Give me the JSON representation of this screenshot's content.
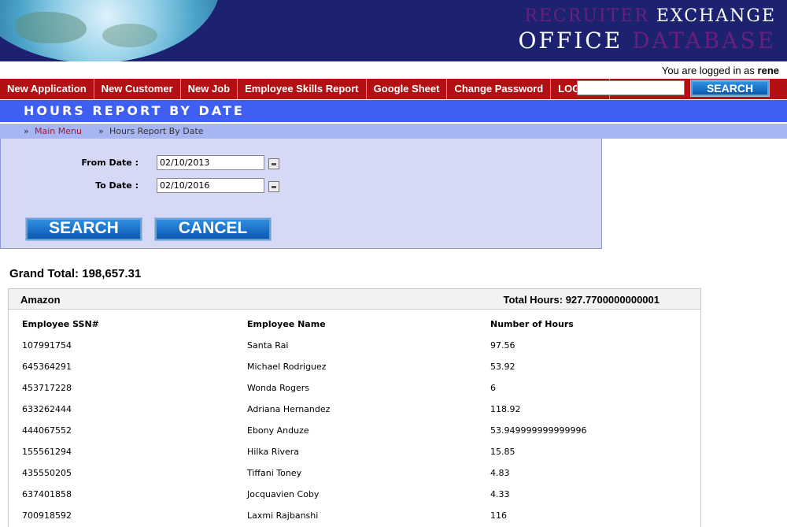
{
  "header": {
    "brand_line1_a": "RECRUITER",
    "brand_line1_b": "EXCHANGE",
    "brand_line2_a": "OFFICE",
    "brand_line2_b": "DATABASE",
    "logged_in_prefix": "You are logged in as",
    "username": "rene"
  },
  "nav": {
    "items": [
      "New Application",
      "New Customer",
      "New Job",
      "Employee Skills Report",
      "Google Sheet",
      "Change Password",
      "LOGOUT"
    ],
    "search_value": "",
    "search_button": "SEARCH"
  },
  "page": {
    "title": "HOURS REPORT BY DATE",
    "breadcrumb_marker": "»",
    "breadcrumb_main": "Main Menu",
    "breadcrumb_current": "Hours Report By Date"
  },
  "form": {
    "from_label": "From Date :",
    "from_value": "02/10/2013",
    "to_label": "To Date :",
    "to_value": "02/10/2016",
    "search_button": "SEARCH",
    "cancel_button": "CANCEL"
  },
  "report": {
    "grand_total_label": "Grand Total:",
    "grand_total_value": "198,657.31",
    "group": {
      "name": "Amazon",
      "total_label": "Total Hours:",
      "total_value": "927.7700000000001",
      "columns": [
        "Employee SSN#",
        "Employee Name",
        "Number of Hours"
      ],
      "rows": [
        [
          "107991754",
          "Santa Rai",
          "97.56"
        ],
        [
          "645364291",
          "Michael Rodriguez",
          "53.92"
        ],
        [
          "453717228",
          "Wonda Rogers",
          "6"
        ],
        [
          "633262444",
          "Adriana Hernandez",
          "118.92"
        ],
        [
          "444067552",
          "Ebony Anduze",
          "53.949999999999996"
        ],
        [
          "155561294",
          "Hilka Rivera",
          "15.85"
        ],
        [
          "435550205",
          "Tiffani Toney",
          "4.83"
        ],
        [
          "637401858",
          "Jocquavien Coby",
          "4.33"
        ],
        [
          "700918592",
          "Laxmi Rajbanshi",
          "116"
        ]
      ]
    }
  },
  "colors": {
    "header_bg": "#1c2270",
    "nav_bg": "#b31014",
    "title_bg": "#3f5ef2",
    "panel_bg": "#d5d9f6",
    "breadcrumb_link": "#a11a2a"
  }
}
